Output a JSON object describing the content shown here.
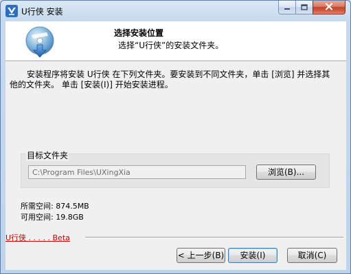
{
  "window": {
    "title": "U行侠 安装"
  },
  "header": {
    "title": "选择安装位置",
    "subtitle": "选择“U行侠”的安装文件夹。"
  },
  "intro": {
    "text": "安装程序将安装 U行侠 在下列文件夹。要安装到不同文件夹，单击 [浏览] 并选择其他的文件夹。 单击 [安装(I)] 开始安装进程。"
  },
  "destination": {
    "label": "目标文件夹",
    "path": "C:\\Program Files\\UXingXia",
    "browse_label": "浏览(B)..."
  },
  "space": {
    "required": "所需空间: 874.5MB",
    "available": "可用空间: 19.8GB"
  },
  "branding": {
    "text": "U行侠 . . . . . Beta"
  },
  "buttons": {
    "back": "< 上一步(B)",
    "install": "安装(I)",
    "cancel": "取消(C)"
  },
  "colors": {
    "accent": "#3c7fb1",
    "brand_text": "#c00000",
    "close_button": "#c2432b"
  },
  "icons": {
    "app": "app-logo-icon",
    "header": "install-disc-icon",
    "minimize": "minimize-icon",
    "maximize": "maximize-icon",
    "close": "close-icon"
  }
}
